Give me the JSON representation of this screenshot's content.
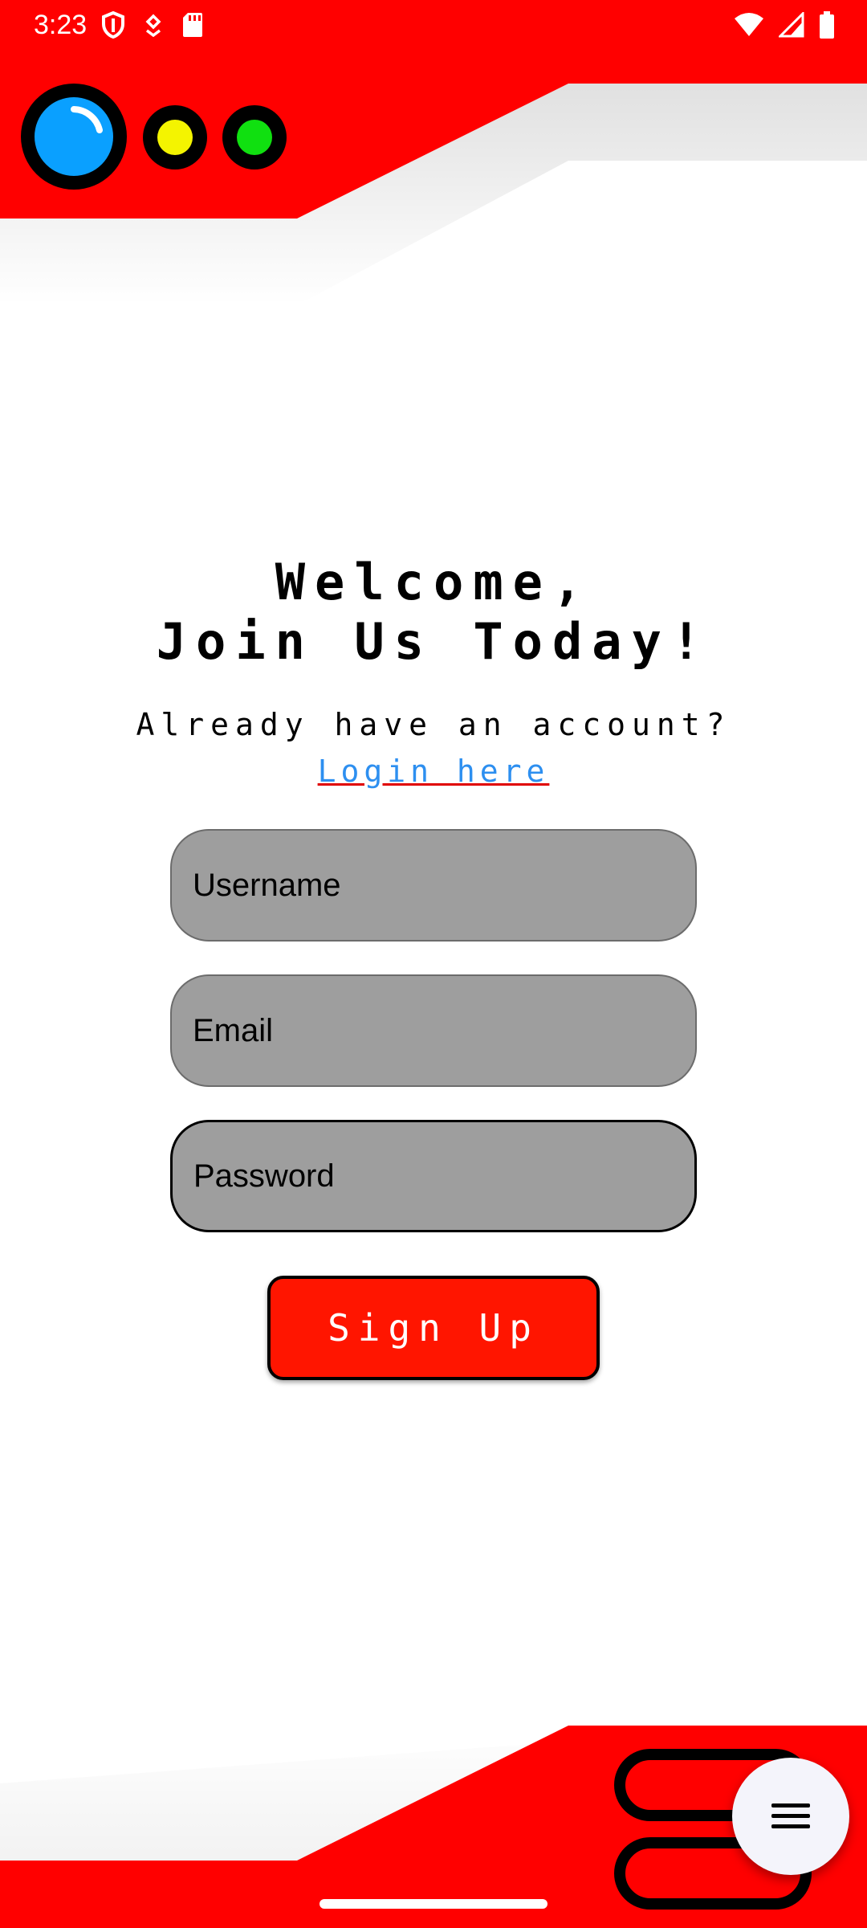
{
  "status_bar": {
    "time": "3:23",
    "left_icons": [
      "shield-icon",
      "notification-icon",
      "sd-card-icon"
    ],
    "right_icons": [
      "wifi-icon",
      "signal-icon",
      "battery-icon"
    ]
  },
  "header": {
    "lights": [
      {
        "name": "big-blue-light",
        "color": "#0aa0ff"
      },
      {
        "name": "yellow-light",
        "color": "#f4f400"
      },
      {
        "name": "green-light",
        "color": "#10e010"
      }
    ],
    "accent_color": "#ff0000"
  },
  "main": {
    "title_line1": "Welcome,",
    "title_line2": "Join Us Today!",
    "already_text": "Already have an account?",
    "login_link": "Login here",
    "fields": {
      "username_placeholder": "Username",
      "email_placeholder": "Email",
      "password_placeholder": "Password"
    },
    "signup_label": "Sign Up"
  },
  "footer": {
    "fab_icon": "menu-icon"
  }
}
